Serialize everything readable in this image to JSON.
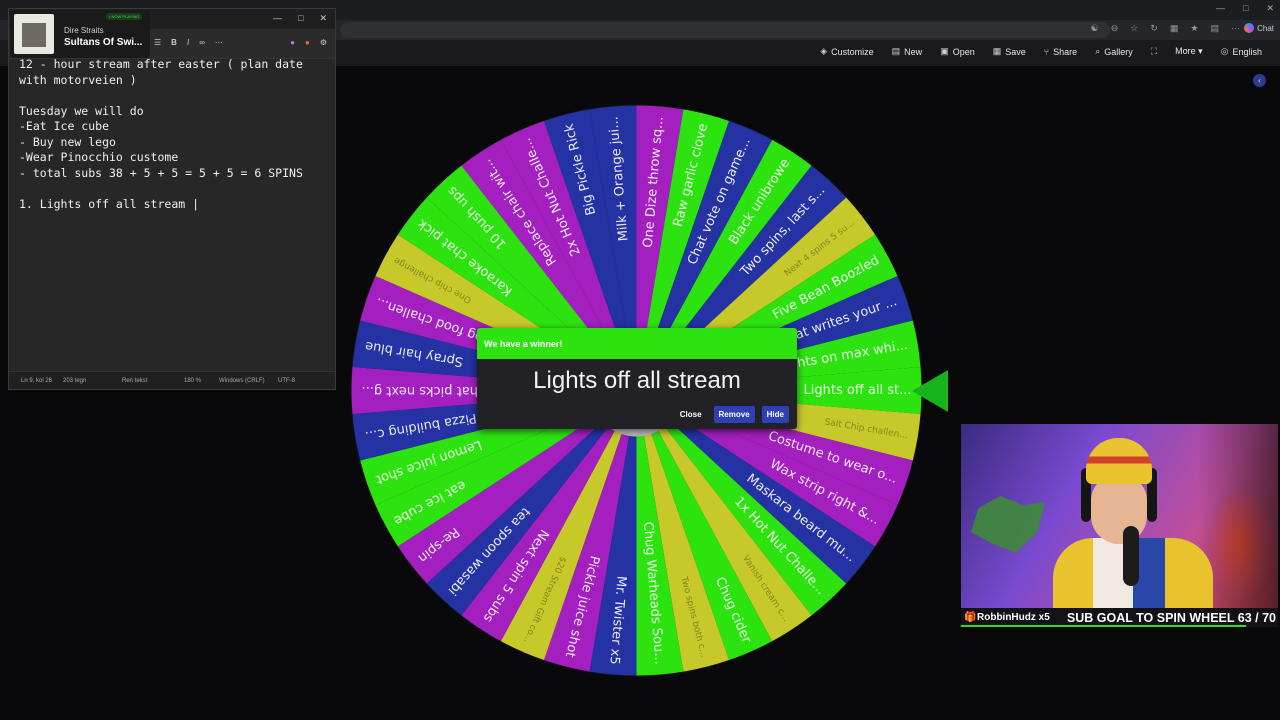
{
  "browser": {
    "chat_label": "Chat"
  },
  "toolbar": {
    "items": [
      {
        "label": "Customize",
        "icon": "palette-icon",
        "glyph": "◈"
      },
      {
        "label": "New",
        "icon": "file-icon",
        "glyph": "▤"
      },
      {
        "label": "Open",
        "icon": "folder-icon",
        "glyph": "▣"
      },
      {
        "label": "Save",
        "icon": "save-icon",
        "glyph": "▦"
      },
      {
        "label": "Share",
        "icon": "share-icon",
        "glyph": "⑂"
      },
      {
        "label": "Gallery",
        "icon": "search-icon",
        "glyph": "⌕"
      },
      {
        "label": "",
        "icon": "fullscreen-icon",
        "glyph": "⛶"
      },
      {
        "label": "More ▾",
        "icon": "",
        "glyph": ""
      },
      {
        "label": "English",
        "icon": "globe-icon",
        "glyph": "◎"
      }
    ]
  },
  "notepad": {
    "lines": [
      "12 - hour stream after easter ( plan date",
      "with motorveien )",
      "",
      "Tuesday we will do",
      "-Eat Ice cube",
      "- Buy new lego",
      "-Wear Pinocchio custome",
      "- total subs 38 + 5 + 5 = 5 + 5 = 6 SPINS",
      "",
      "1. Lights off all stream |"
    ],
    "status": {
      "position": "Ln 9, kol 26",
      "chars": "203 tegn",
      "format": "Ren tekst",
      "zoom": "180 %",
      "line_endings": "Windows (CRLF)",
      "encoding": "UTF-8"
    }
  },
  "spotify": {
    "artist": "Dire Straits",
    "track": "Sultans Of Swi...",
    "badge": "• NOW PLAYING",
    "progress": 0.25
  },
  "wheel": {
    "colors": {
      "green": "#2ce310",
      "purple": "#a31fbf",
      "blue": "#2432a3",
      "yellow": "#c7c92a"
    },
    "entries": [
      {
        "label": "Lights off all st...",
        "color": "green"
      },
      {
        "label": "Salt Chip challen...",
        "color": "yellow"
      },
      {
        "label": "Costume to wear o...",
        "color": "purple"
      },
      {
        "label": "Wax strip right &...",
        "color": "purple"
      },
      {
        "label": "Maskara beard mu...",
        "color": "blue"
      },
      {
        "label": "1x Hot Nut Challe...",
        "color": "green"
      },
      {
        "label": "Vanish cream c...",
        "color": "yellow"
      },
      {
        "label": "Chug cider",
        "color": "green"
      },
      {
        "label": "Two spins both c...",
        "color": "yellow"
      },
      {
        "label": "Chug Warheads Sou...",
        "color": "green"
      },
      {
        "label": "Mr. Twister x5",
        "color": "blue"
      },
      {
        "label": "Pickle juice shot",
        "color": "purple"
      },
      {
        "label": "$20 Stream Gift co...",
        "color": "yellow"
      },
      {
        "label": "Next spin 5 subs",
        "color": "purple"
      },
      {
        "label": "tea spoon wasabi",
        "color": "blue"
      },
      {
        "label": "Re-spin",
        "color": "purple"
      },
      {
        "label": "eat ice cube",
        "color": "green"
      },
      {
        "label": "Lemon juice shot",
        "color": "green"
      },
      {
        "label": "Pizza building c...",
        "color": "blue"
      },
      {
        "label": "Chat picks next g...",
        "color": "purple"
      },
      {
        "label": "Spray hair blue",
        "color": "blue"
      },
      {
        "label": "Dog food challen...",
        "color": "purple"
      },
      {
        "label": "One chip challenge",
        "color": "yellow"
      },
      {
        "label": "Karaoke chat pick",
        "color": "green"
      },
      {
        "label": "10 push ups",
        "color": "green"
      },
      {
        "label": "Replace chair wit...",
        "color": "purple"
      },
      {
        "label": "2x Hot Nut Challe...",
        "color": "purple"
      },
      {
        "label": "Big Pickle Rick",
        "color": "blue"
      },
      {
        "label": "Milk + Orange jui...",
        "color": "blue"
      },
      {
        "label": "One Dize throw sq...",
        "color": "purple"
      },
      {
        "label": "Raw garlic clove",
        "color": "green"
      },
      {
        "label": "Chat vote on game...",
        "color": "blue"
      },
      {
        "label": "Black unibrowe",
        "color": "green"
      },
      {
        "label": "Two spins, last s...",
        "color": "blue"
      },
      {
        "label": "Next 4 spins 5 su...",
        "color": "yellow"
      },
      {
        "label": "Five Bean Boozled",
        "color": "green"
      },
      {
        "label": "Chat writes your ...",
        "color": "blue"
      },
      {
        "label": "Lights on max whi...",
        "color": "green"
      }
    ]
  },
  "winner_dialog": {
    "title": "We have a winner!",
    "name": "Lights off all stream",
    "buttons": {
      "close": "Close",
      "remove": "Remove",
      "hide": "Hide"
    }
  },
  "subgoal": {
    "user": "RobbinHudz x5",
    "text": "SUB GOAL TO SPIN WHEEL 63 / 70",
    "current": 63,
    "target": 70
  }
}
